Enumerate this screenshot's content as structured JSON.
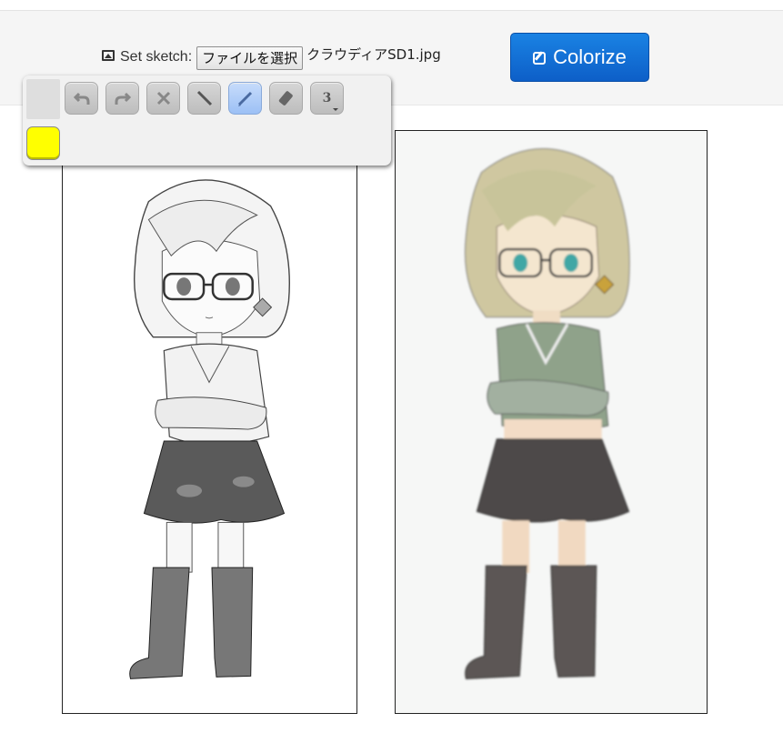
{
  "header": {
    "set_sketch_label": "Set sketch:",
    "file_button_label": "ファイルを選択",
    "file_name": "クラウディアSD1.jpg",
    "colorize_label": "Colorize",
    "image_icon": "image-icon",
    "colorize_icon": "edit-icon"
  },
  "toolbar": {
    "tools": [
      {
        "name": "undo",
        "icon": "undo-icon",
        "active": false
      },
      {
        "name": "redo",
        "icon": "redo-icon",
        "active": false
      },
      {
        "name": "clear",
        "icon": "close-icon",
        "active": false
      },
      {
        "name": "line",
        "icon": "line-icon",
        "active": false
      },
      {
        "name": "pen",
        "icon": "pen-icon",
        "active": true
      },
      {
        "name": "eraser",
        "icon": "eraser-icon",
        "active": false
      },
      {
        "name": "size",
        "icon": "size-icon",
        "active": false
      }
    ],
    "pen_size": "3",
    "selected_color": "#ffff00"
  },
  "colors": {
    "accent": "#0d6fd8",
    "header_bg": "#f5f5f5"
  }
}
